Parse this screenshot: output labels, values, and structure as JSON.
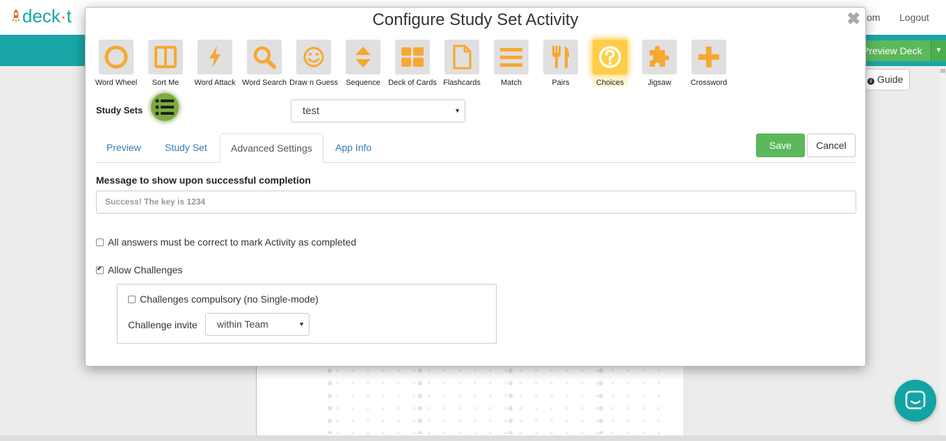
{
  "app": {
    "logo_text_a": "deck",
    "logo_dot": "·",
    "logo_text_b": "t",
    "top_link_partial": "om",
    "logout": "Logout",
    "preview_deck": "Preview Deck",
    "guide": "Guide"
  },
  "modal": {
    "title": "Configure Study Set Activity",
    "close_icon": "close-x-icon",
    "apps": [
      {
        "label": "Word Wheel",
        "icon": "circle-icon"
      },
      {
        "label": "Sort Me",
        "icon": "columns-icon"
      },
      {
        "label": "Word Attack",
        "icon": "lightning-icon"
      },
      {
        "label": "Word Search",
        "icon": "magnifier-icon"
      },
      {
        "label": "Draw n Guess",
        "icon": "smiley-icon"
      },
      {
        "label": "Sequence",
        "icon": "up-down-arrows-icon"
      },
      {
        "label": "Deck of Cards",
        "icon": "grid-cards-icon"
      },
      {
        "label": "Flashcards",
        "icon": "document-icon"
      },
      {
        "label": "Match",
        "icon": "hamburger-lines-icon"
      },
      {
        "label": "Pairs",
        "icon": "fork-knife-icon"
      },
      {
        "label": "Choices",
        "icon": "question-circle-icon",
        "active": true
      },
      {
        "label": "Jigsaw",
        "icon": "puzzle-icon"
      },
      {
        "label": "Crossword",
        "icon": "plus-icon"
      }
    ],
    "study_sets_label": "Study Sets",
    "study_set_selected": "test",
    "tabs": [
      "Preview",
      "Study Set",
      "Advanced Settings",
      "App Info"
    ],
    "active_tab": "Advanced Settings",
    "save": "Save",
    "cancel": "Cancel",
    "message_label": "Message to show upon successful completion",
    "message_value": "Success! The key is 1234",
    "all_correct_label": "All answers must be correct to mark Activity as completed",
    "all_correct_checked": false,
    "allow_challenges_label": "Allow Challenges",
    "allow_challenges_checked": true,
    "challenges_compulsory_label": "Challenges compulsory (no Single-mode)",
    "challenges_compulsory_checked": false,
    "challenge_invite_label": "Challenge invite",
    "challenge_invite_selected": "within Team"
  },
  "colors": {
    "accent_orange": "#f7a830",
    "teal": "#1aa6a6",
    "green": "#5cb85c",
    "link_blue": "#337ab7"
  }
}
